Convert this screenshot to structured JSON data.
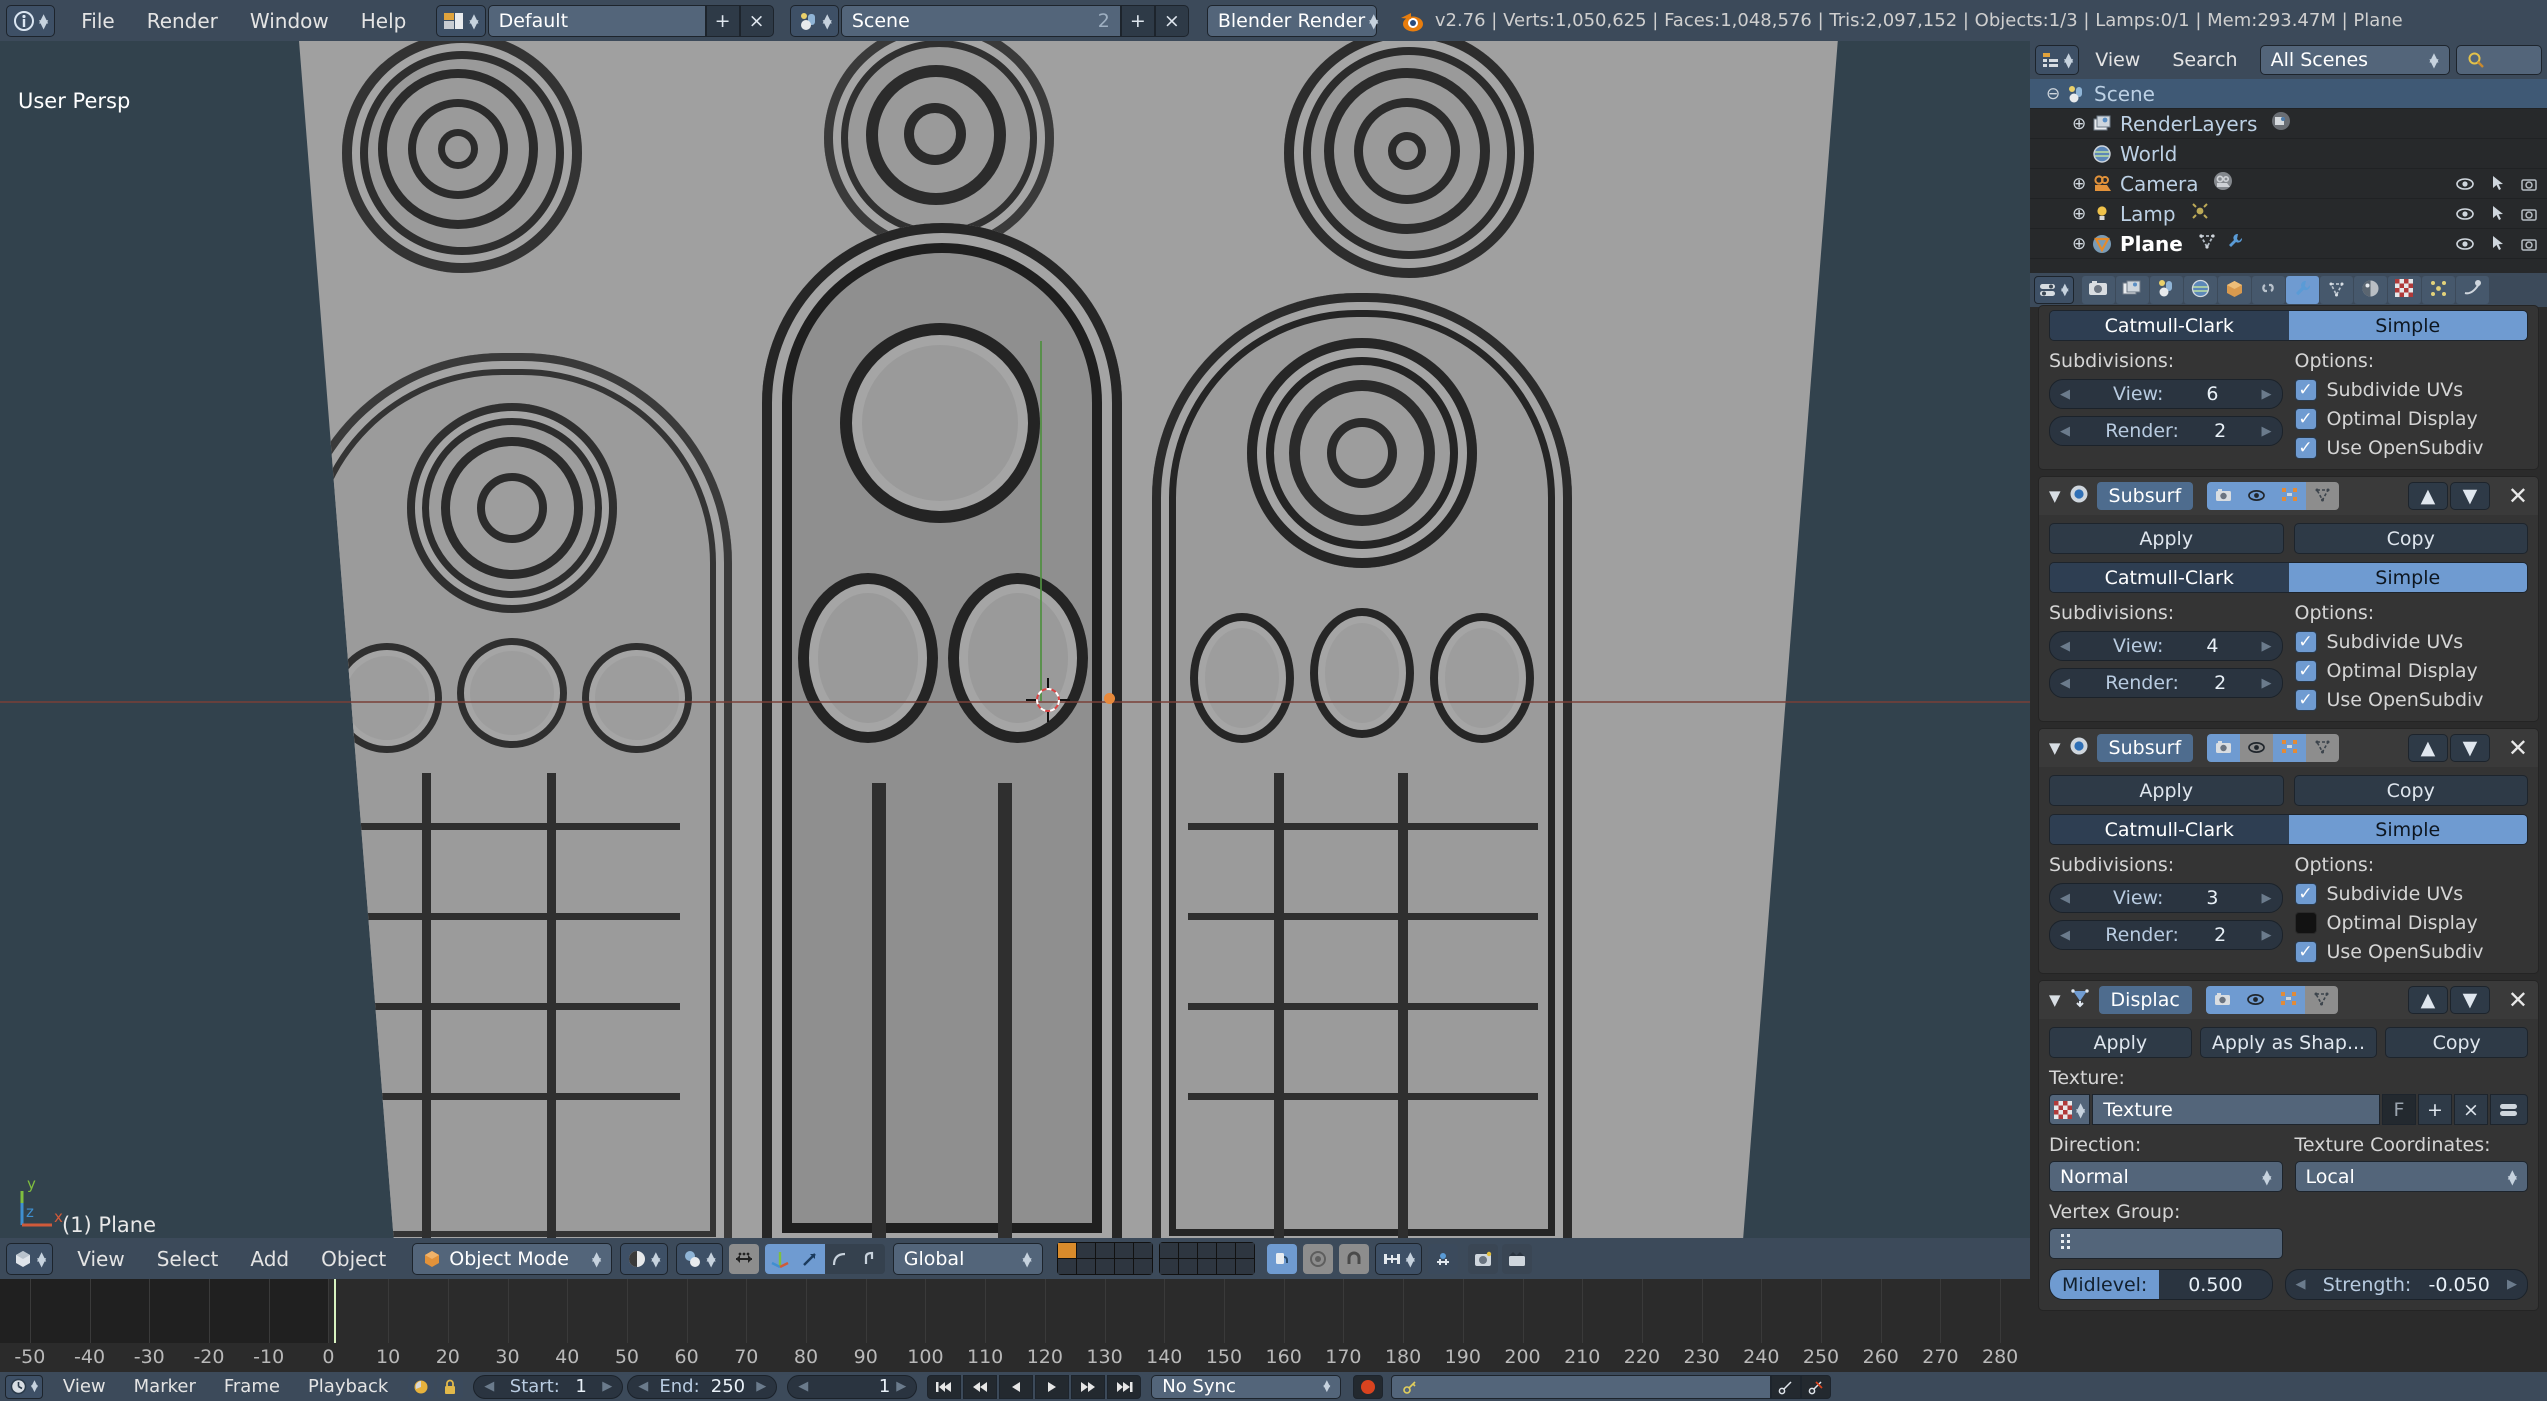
{
  "topbar": {
    "info_icon": "info-icon",
    "menus": [
      "File",
      "Render",
      "Window",
      "Help"
    ],
    "screen_layout": {
      "icon": "screen-layout-icon",
      "value": "Default",
      "add": "+",
      "remove": "×"
    },
    "scene": {
      "icon": "scene-icon",
      "value": "Scene",
      "users": "2",
      "add": "+",
      "remove": "×"
    },
    "engine": {
      "value": "Blender Render"
    },
    "blender_icon": "blender-logo-icon",
    "stats": "v2.76 | Verts:1,050,625 | Faces:1,048,576 | Tris:2,097,152 | Objects:1/3 | Lamps:0/1 | Mem:293.47M | Plane",
    "stats_parts": {
      "version": "v2.76",
      "verts": "Verts:1,050,625",
      "faces": "Faces:1,048,576",
      "tris": "Tris:2,097,152",
      "objects": "Objects:1/3",
      "lamps": "Lamps:0/1",
      "mem": "Mem:293.47M",
      "active": "Plane"
    }
  },
  "viewport": {
    "view_label": "User Persp",
    "object_label": "(1) Plane",
    "axis": {
      "x": "x",
      "y": "y",
      "z": "z"
    },
    "header": {
      "editor_icon": "editor-type-3dview-icon",
      "menus": [
        "View",
        "Select",
        "Add",
        "Object"
      ],
      "mode": {
        "icon": "object-mode-icon",
        "value": "Object Mode"
      },
      "shading_icon": "viewport-shading-icon",
      "pivot_icon": "pivot-point-icon",
      "manipulator_icon": "manipulator-toggle-icon",
      "transform_translate_icon": "translate-manipulator-icon",
      "transform_rotate_icon": "rotate-manipulator-icon",
      "transform_scale_icon": "scale-manipulator-icon",
      "orientation": "Global",
      "layers_label": "scene-layers",
      "lock_icon": "lock-object-modes-icon",
      "proportional_icon": "proportional-edit-icon",
      "snap_icon": "snap-magnet-icon",
      "snap_target_icon": "snap-element-icon",
      "render_icon": "render-opengl-icon",
      "render_anim_icon": "render-opengl-anim-icon"
    }
  },
  "timeline": {
    "ticks": [
      -50,
      -40,
      -30,
      -20,
      -10,
      0,
      10,
      20,
      30,
      40,
      50,
      60,
      70,
      80,
      90,
      100,
      110,
      120,
      130,
      140,
      150,
      160,
      170,
      180,
      190,
      200,
      210,
      220,
      230,
      240,
      250,
      260,
      270,
      280
    ],
    "current_frame": 1,
    "range_start": -55,
    "range_end": 285
  },
  "statusbar": {
    "editor_icon": "editor-type-timeline-icon",
    "menus": [
      "View",
      "Marker",
      "Frame",
      "Playback"
    ],
    "autokey_icon": "record-autokey-icon",
    "lock_icon": "lock-icon",
    "start": {
      "label": "Start:",
      "value": "1"
    },
    "end": {
      "label": "End:",
      "value": "250"
    },
    "frame": {
      "value": "1"
    },
    "transport": [
      "jump-start-icon",
      "prev-keyframe-icon",
      "play-reverse-icon",
      "play-icon",
      "next-keyframe-icon",
      "jump-end-icon"
    ],
    "sync": "No Sync",
    "record_icon": "record-icon",
    "keyingset_icon": "keying-set-icon",
    "keyingset_value": "",
    "insert_key_icon": "insert-keyframe-icon",
    "delete_key_icon": "delete-keyframe-icon"
  },
  "outliner": {
    "header": {
      "editor_icon": "editor-type-outliner-icon",
      "menus": [
        "View",
        "Search"
      ],
      "display_mode": "All Scenes",
      "search_icon": "search-icon",
      "search_value": ""
    },
    "rows": [
      {
        "name": "Scene",
        "icon": "scene-icon",
        "expander": "minus",
        "indent": 0,
        "selected": true,
        "bold": false,
        "eye": false
      },
      {
        "name": "RenderLayers",
        "icon": "renderlayers-icon",
        "expander": "plus",
        "indent": 1,
        "selected": false,
        "bold": false,
        "eye": false,
        "extra_icon": "renderlayers-data-icon"
      },
      {
        "name": "World",
        "icon": "world-icon",
        "expander": "none",
        "indent": 1,
        "selected": false,
        "bold": false,
        "eye": false
      },
      {
        "name": "Camera",
        "icon": "camera-icon",
        "expander": "plus",
        "indent": 1,
        "selected": false,
        "bold": false,
        "eye": true,
        "extra_icon": "camera-data-icon"
      },
      {
        "name": "Lamp",
        "icon": "lamp-icon",
        "expander": "plus",
        "indent": 1,
        "selected": false,
        "bold": false,
        "eye": true,
        "extra_icon": "lamp-data-icon"
      },
      {
        "name": "Plane",
        "icon": "mesh-triangle-icon",
        "expander": "plus",
        "indent": 1,
        "selected": false,
        "bold": true,
        "eye": true,
        "extra_icon": "mesh-data-icon",
        "extra_icon2": "wrench-modifier-icon"
      }
    ],
    "restrict_icons": [
      "restrict-view-eye-icon",
      "restrict-select-cursor-icon",
      "restrict-render-camera-icon"
    ]
  },
  "properties": {
    "header": {
      "editor_icon": "editor-type-properties-icon",
      "tabs": [
        {
          "name": "render-tab",
          "icon": "camera-back-icon",
          "active": false
        },
        {
          "name": "renderlayers-tab",
          "icon": "images-icon",
          "active": false
        },
        {
          "name": "scene-tab",
          "icon": "scene-icon",
          "active": false
        },
        {
          "name": "world-tab",
          "icon": "world-globe-icon",
          "active": false
        },
        {
          "name": "object-tab",
          "icon": "cube-icon",
          "active": false
        },
        {
          "name": "constraints-tab",
          "icon": "chain-link-icon",
          "active": false
        },
        {
          "name": "modifiers-tab",
          "icon": "wrench-icon",
          "active": true
        },
        {
          "name": "data-tab",
          "icon": "mesh-data-icon",
          "active": false
        },
        {
          "name": "material-tab",
          "icon": "material-sphere-icon",
          "active": false
        },
        {
          "name": "texture-tab",
          "icon": "checker-texture-icon",
          "active": false
        },
        {
          "name": "particles-tab",
          "icon": "particles-icon",
          "active": false
        },
        {
          "name": "physics-tab",
          "icon": "physics-icon",
          "active": false
        }
      ]
    },
    "modifiers": [
      {
        "id": "subsurf-top-partial",
        "type": "Subsurf",
        "partial": true,
        "subdiv_type": {
          "catmull": "Catmull-Clark",
          "simple": "Simple",
          "selected": "Simple"
        },
        "subdivisions_label": "Subdivisions:",
        "options_label": "Options:",
        "view": {
          "label": "View:",
          "value": "6"
        },
        "render": {
          "label": "Render:",
          "value": "2"
        },
        "options": [
          {
            "label": "Subdivide UVs",
            "checked": true
          },
          {
            "label": "Optimal Display",
            "checked": true
          },
          {
            "label": "Use OpenSubdiv",
            "checked": true
          }
        ]
      },
      {
        "id": "subsurf-2",
        "type": "Subsurf",
        "partial": false,
        "icon": "modifier-subsurf-icon",
        "display_toggles": [
          {
            "name": "render-toggle-icon",
            "on": true
          },
          {
            "name": "realtime-eye-icon",
            "on": true
          },
          {
            "name": "editmode-toggle-icon",
            "on": true
          },
          {
            "name": "oncage-toggle-icon",
            "on": false
          }
        ],
        "move_up_icon": "move-up-icon",
        "move_down_icon": "move-down-icon",
        "close_icon": "close-x-icon",
        "apply": "Apply",
        "copy": "Copy",
        "subdiv_type": {
          "catmull": "Catmull-Clark",
          "simple": "Simple",
          "selected": "Simple"
        },
        "subdivisions_label": "Subdivisions:",
        "options_label": "Options:",
        "view": {
          "label": "View:",
          "value": "4"
        },
        "render": {
          "label": "Render:",
          "value": "2"
        },
        "options": [
          {
            "label": "Subdivide UVs",
            "checked": true
          },
          {
            "label": "Optimal Display",
            "checked": true
          },
          {
            "label": "Use OpenSubdiv",
            "checked": true
          }
        ]
      },
      {
        "id": "subsurf-3",
        "type": "Subsurf",
        "partial": false,
        "icon": "modifier-subsurf-icon",
        "display_toggles": [
          {
            "name": "render-toggle-icon",
            "on": true
          },
          {
            "name": "realtime-eye-icon",
            "on": false
          },
          {
            "name": "editmode-toggle-icon",
            "on": true
          },
          {
            "name": "oncage-toggle-icon",
            "on": false
          }
        ],
        "move_up_icon": "move-up-icon",
        "move_down_icon": "move-down-icon",
        "close_icon": "close-x-icon",
        "apply": "Apply",
        "copy": "Copy",
        "subdiv_type": {
          "catmull": "Catmull-Clark",
          "simple": "Simple",
          "selected": "Simple"
        },
        "subdivisions_label": "Subdivisions:",
        "options_label": "Options:",
        "view": {
          "label": "View:",
          "value": "3"
        },
        "render": {
          "label": "Render:",
          "value": "2"
        },
        "options": [
          {
            "label": "Subdivide UVs",
            "checked": true
          },
          {
            "label": "Optimal Display",
            "checked": false
          },
          {
            "label": "Use OpenSubdiv",
            "checked": true
          }
        ]
      },
      {
        "id": "displace",
        "type": "Displac",
        "partial": false,
        "icon": "modifier-displace-icon",
        "display_toggles": [
          {
            "name": "render-toggle-icon",
            "on": true
          },
          {
            "name": "realtime-eye-icon",
            "on": true
          },
          {
            "name": "editmode-toggle-icon",
            "on": true
          },
          {
            "name": "oncage-toggle-icon",
            "on": false
          }
        ],
        "move_up_icon": "move-up-icon",
        "move_down_icon": "move-down-icon",
        "close_icon": "close-x-icon",
        "apply": "Apply",
        "apply_as_shape": "Apply as Shap...",
        "copy": "Copy",
        "texture_label": "Texture:",
        "texture_icon": "checker-texture-icon",
        "texture_value": "Texture",
        "texture_fake_user": "F",
        "texture_new": "+",
        "texture_unlink": "×",
        "texture_browse": "browse-texture-icon",
        "direction_label": "Direction:",
        "direction_value": "Normal",
        "texcoords_label": "Texture Coordinates:",
        "texcoords_value": "Local",
        "vertexgroup_label": "Vertex Group:",
        "vertexgroup_icon": "vertex-group-icon",
        "vertexgroup_value": "",
        "midlevel": {
          "label": "Midlevel:",
          "value": "0.500"
        },
        "strength": {
          "label": "Strength:",
          "value": "-0.050"
        }
      }
    ]
  }
}
